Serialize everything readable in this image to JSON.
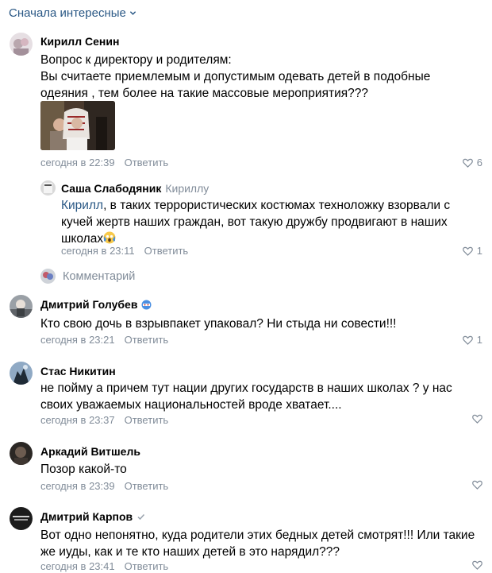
{
  "sort": {
    "label": "Сначала интересные"
  },
  "comments": [
    {
      "author": "Кирилл Сенин",
      "lines": [
        "Вопрос к директору и родителям:",
        "Вы считаете приемлемым и допустимым одевать детей в подобные",
        "одеяния , тем более на такие массовые мероприятия???"
      ],
      "date": "сегодня в 22:39",
      "reply_label": "Ответить",
      "likes": "6"
    },
    {
      "author": "Саша Слабодяник",
      "reply_to": "Кириллу",
      "mention": "Кирилл",
      "lines": [
        ", в таких террористических костюмах техноложку взорвали с",
        "кучей жертв наших граждан, вот такую дружбу продвигают в наших",
        "школах"
      ],
      "date": "сегодня в 23:11",
      "reply_label": "Ответить",
      "likes": "1"
    },
    {
      "author": "Дмитрий Голубев",
      "lines": [
        "Кто свою дочь в взрывпакет упаковал? Ни стыда ни совести!!!"
      ],
      "date": "сегодня в 23:21",
      "reply_label": "Ответить",
      "likes": "1"
    },
    {
      "author": "Стас Никитин",
      "lines": [
        "не пойму а причем тут нации других государств в наших школах ? у нас",
        "своих уважаемых национальностей вроде хватает...."
      ],
      "date": "сегодня в 23:37",
      "reply_label": "Ответить",
      "likes": ""
    },
    {
      "author": "Аркадий Витшель",
      "lines": [
        "Позор какой-то"
      ],
      "date": "сегодня в 23:39",
      "reply_label": "Ответить",
      "likes": ""
    },
    {
      "author": "Дмитрий Карпов",
      "lines": [
        "Вот одно непонятно, куда родители этих бедных детей смотрят!!! Или такие",
        "же иуды, как и те кто наших детей в это нарядил???"
      ],
      "date": "сегодня в 23:41",
      "reply_label": "Ответить",
      "likes": ""
    }
  ],
  "add_comment": {
    "label": "Комментарий"
  },
  "colors": {
    "link": "#2a5885",
    "muted": "#818c99",
    "text": "#000000"
  },
  "icons": {
    "like": "heart-outline-icon",
    "sort": "chevron-down-icon"
  }
}
